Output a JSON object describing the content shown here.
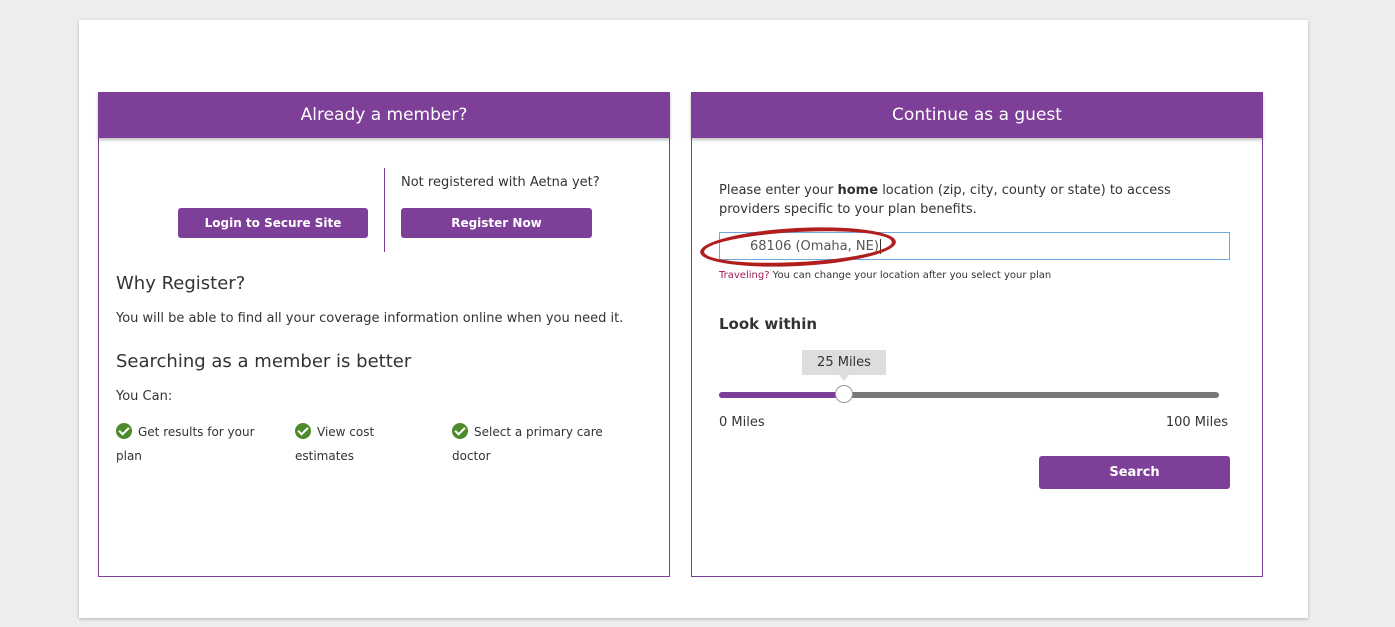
{
  "member": {
    "header": "Already a member?",
    "login_label": "Login to Secure Site",
    "not_registered": "Not registered with Aetna yet?",
    "register_label": "Register Now",
    "why_title": "Why Register?",
    "why_text": "You will be able to find all your coverage information online when you need it.",
    "better_title": "Searching as a member is better",
    "you_can": "You Can:",
    "benefits": [
      {
        "line1": "Get results for your",
        "line2": "plan"
      },
      {
        "line1": "View cost",
        "line2": "estimates"
      },
      {
        "line1": "Select a primary care",
        "line2": "doctor"
      }
    ]
  },
  "guest": {
    "header": "Continue as a guest",
    "intro_before": "Please enter your ",
    "intro_bold": "home",
    "intro_after": " location (zip, city, county or state) to access",
    "intro_line2": "providers specific to your plan benefits.",
    "location_value": "68106 (Omaha, NE)",
    "traveling_label": "Traveling?",
    "traveling_text": " You can change your location after you select your plan",
    "look_within": "Look within",
    "slider": {
      "value": 25,
      "max": 100,
      "tooltip": "25 Miles",
      "min_label": "0 Miles",
      "max_label": "100 Miles"
    },
    "search_label": "Search"
  },
  "colors": {
    "brand_purple": "#7d3f98",
    "check_green": "#4c8a2b",
    "annotation_red": "#b01e1e"
  }
}
